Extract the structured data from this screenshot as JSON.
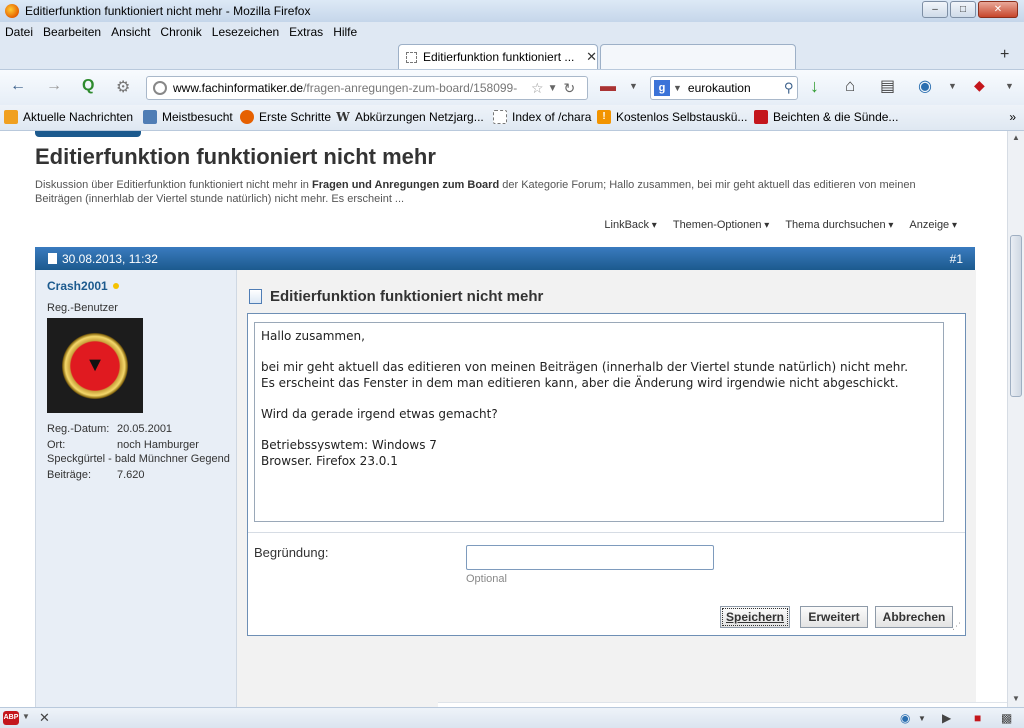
{
  "window": {
    "title": "Editierfunktion funktioniert nicht mehr - Mozilla Firefox"
  },
  "menu": [
    "Datei",
    "Bearbeiten",
    "Ansicht",
    "Chronik",
    "Lesezeichen",
    "Extras",
    "Hilfe"
  ],
  "tabs": [
    {
      "label": "Editierfunktion funktioniert ...",
      "active": true
    },
    {
      "label": "",
      "active": false
    }
  ],
  "urlbar": {
    "domain": "www.fachinformatiker.de",
    "path": "/fragen-anregungen-zum-board/158099-"
  },
  "search": {
    "engine_icon": "google-icon",
    "value": "eurokaution"
  },
  "bookmarks": [
    {
      "label": "Aktuelle Nachrichten",
      "icon": "rss-icon",
      "color": "#f0a020"
    },
    {
      "label": "Meistbesucht",
      "icon": "page-icon",
      "color": "#4f7db5"
    },
    {
      "label": "Erste Schritte",
      "icon": "firefox-icon",
      "color": "#e66000"
    },
    {
      "label": "Abkürzungen Netzjarg...",
      "icon": "wikipedia-icon",
      "color": "#555555"
    },
    {
      "label": "Index of /chara",
      "icon": "blank-page-icon",
      "color": "#ffffff"
    },
    {
      "label": "Kostenlos Selbstauskü...",
      "icon": "warning-icon",
      "color": "#f29400"
    },
    {
      "label": "Beichten & die Sünde...",
      "icon": "lock-icon",
      "color": "#c4161c"
    }
  ],
  "thread": {
    "title": "Editierfunktion funktioniert nicht mehr",
    "desc_prefix": "Diskussion über Editierfunktion funktioniert nicht mehr in ",
    "desc_forum": "Fragen und Anregungen zum Board",
    "desc_suffix": " der Kategorie Forum; Hallo zusammen, bei mir geht aktuell das editieren von meinen Beiträgen (innerhlab der Viertel stunde natürlich) nicht mehr. Es erscheint ..."
  },
  "tools": [
    "LinkBack",
    "Themen-Optionen",
    "Thema durchsuchen",
    "Anzeige"
  ],
  "post": {
    "date": "30.08.2013, 11:32",
    "number": "#1",
    "title": "Editierfunktion funktioniert nicht mehr",
    "text": "Hallo zusammen,\n\nbei mir geht aktuell das editieren von meinen Beiträgen (innerhalb der Viertel stunde natürlich) nicht mehr.\nEs erscheint das Fenster in dem man editieren kann, aber die Änderung wird irgendwie nicht abgeschickt.\n\nWird da gerade irgend etwas gemacht?\n\nBetriebssyswtem: Windows 7\nBrowser. Firefox 23.0.1"
  },
  "user": {
    "name": "Crash2001",
    "title": "Reg.-Benutzer",
    "reg_label": "Reg.-Datum:",
    "reg_value": "20.05.2001",
    "loc_label": "Ort:",
    "loc_value": "noch Hamburger",
    "loc_cont": "Speckgürtel - bald Münchner Gegend",
    "posts_label": "Beiträge:",
    "posts_value": "7.620"
  },
  "edit": {
    "reason_label": "Begründung:",
    "reason_hint": "Optional",
    "reason_value": "",
    "save": "Speichern",
    "advanced": "Erweitert",
    "cancel": "Abbrechen"
  },
  "colors": {
    "header_blue": "#1c5a8e",
    "username_blue": "#1c5a8e",
    "sidebar_bg": "#e8eef6"
  }
}
